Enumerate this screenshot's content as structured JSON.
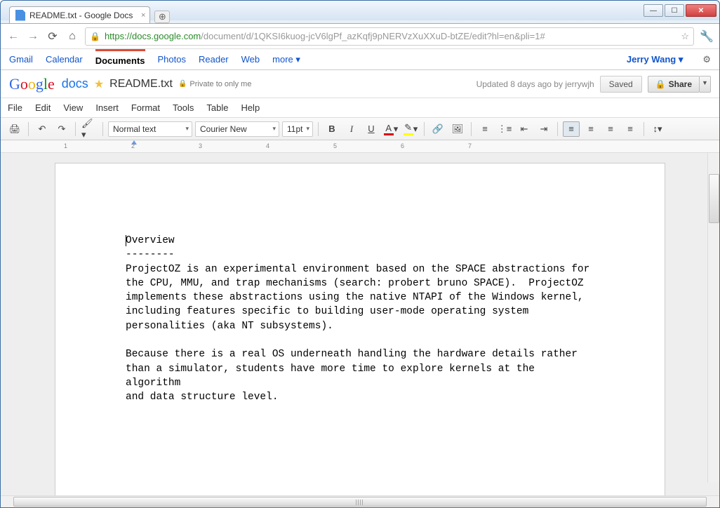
{
  "window": {
    "tab_title": "README.txt - Google Docs"
  },
  "browser": {
    "url_secure": "https://",
    "url_domain": "docs.google.com",
    "url_path": "/document/d/1QKSI6kuog-jcV6lgPf_azKqfj9pNERVzXuXXuD-btZE/edit?hl=en&pli=1#"
  },
  "gbar": {
    "links": [
      "Gmail",
      "Calendar",
      "Documents",
      "Photos",
      "Reader",
      "Web",
      "more"
    ],
    "active": "Documents",
    "user": "Jerry Wang"
  },
  "doc": {
    "logo_docs": "docs",
    "title": "README.txt",
    "privacy": "Private to only me",
    "updated": "Updated 8 days ago by jerrywjh",
    "saved": "Saved",
    "share": "Share"
  },
  "menus": [
    "File",
    "Edit",
    "View",
    "Insert",
    "Format",
    "Tools",
    "Table",
    "Help"
  ],
  "toolbar": {
    "style": "Normal text",
    "font": "Courier New",
    "size": "11pt"
  },
  "ruler": {
    "nums": [
      "1",
      "2",
      "3",
      "4",
      "5",
      "6",
      "7"
    ]
  },
  "content": "Overview\n--------\nProjectOZ is an experimental environment based on the SPACE abstractions for\nthe CPU, MMU, and trap mechanisms (search: probert bruno SPACE).  ProjectOZ\nimplements these abstractions using the native NTAPI of the Windows kernel,\nincluding features specific to building user-mode operating system\npersonalities (aka NT subsystems).\n\nBecause there is a real OS underneath handling the hardware details rather\nthan a simulator, students have more time to explore kernels at the algorithm\nand data structure level."
}
